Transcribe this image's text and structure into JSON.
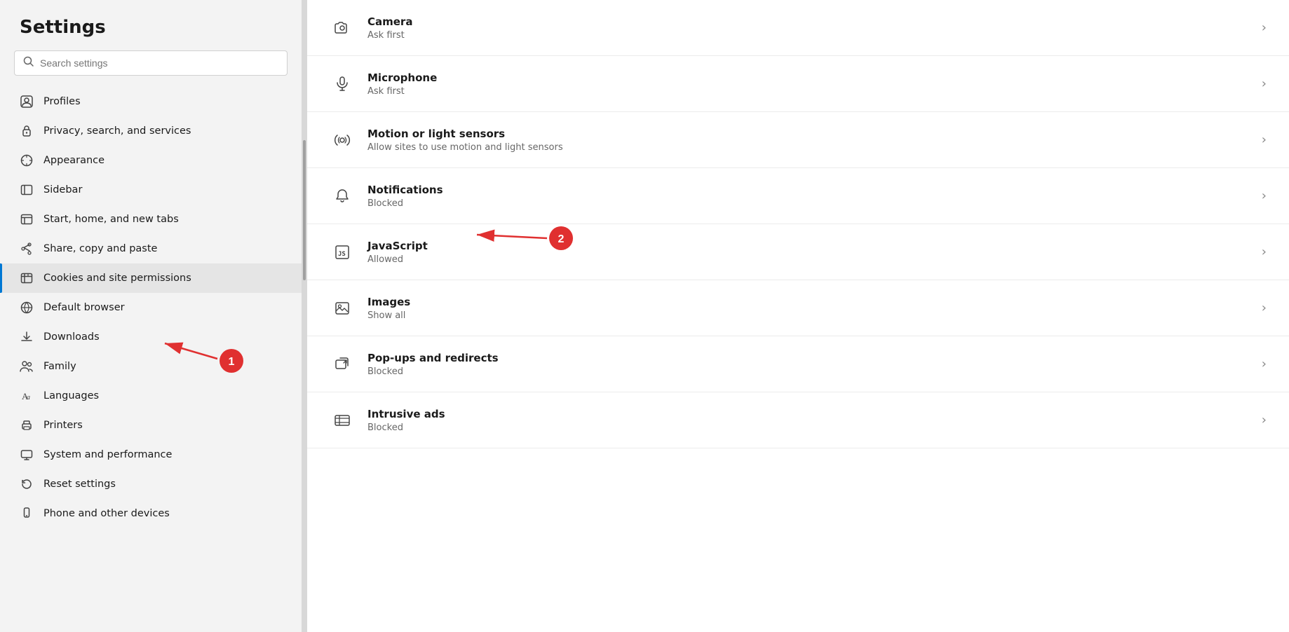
{
  "sidebar": {
    "title": "Settings",
    "search": {
      "placeholder": "Search settings"
    },
    "items": [
      {
        "id": "profiles",
        "label": "Profiles",
        "icon": "profile"
      },
      {
        "id": "privacy",
        "label": "Privacy, search, and services",
        "icon": "privacy"
      },
      {
        "id": "appearance",
        "label": "Appearance",
        "icon": "appearance"
      },
      {
        "id": "sidebar",
        "label": "Sidebar",
        "icon": "sidebar"
      },
      {
        "id": "start-home",
        "label": "Start, home, and new tabs",
        "icon": "start-home"
      },
      {
        "id": "share-copy",
        "label": "Share, copy and paste",
        "icon": "share"
      },
      {
        "id": "cookies",
        "label": "Cookies and site permissions",
        "icon": "cookies",
        "active": true
      },
      {
        "id": "default-browser",
        "label": "Default browser",
        "icon": "browser"
      },
      {
        "id": "downloads",
        "label": "Downloads",
        "icon": "downloads"
      },
      {
        "id": "family",
        "label": "Family",
        "icon": "family"
      },
      {
        "id": "languages",
        "label": "Languages",
        "icon": "languages"
      },
      {
        "id": "printers",
        "label": "Printers",
        "icon": "printers"
      },
      {
        "id": "system",
        "label": "System and performance",
        "icon": "system"
      },
      {
        "id": "reset",
        "label": "Reset settings",
        "icon": "reset"
      },
      {
        "id": "phone",
        "label": "Phone and other devices",
        "icon": "phone"
      }
    ]
  },
  "permissions": [
    {
      "id": "camera",
      "title": "Camera",
      "subtitle": "Ask first",
      "icon": "camera"
    },
    {
      "id": "microphone",
      "title": "Microphone",
      "subtitle": "Ask first",
      "icon": "microphone"
    },
    {
      "id": "motion",
      "title": "Motion or light sensors",
      "subtitle": "Allow sites to use motion and light sensors",
      "icon": "sensors"
    },
    {
      "id": "notifications",
      "title": "Notifications",
      "subtitle": "Blocked",
      "icon": "notifications"
    },
    {
      "id": "javascript",
      "title": "JavaScript",
      "subtitle": "Allowed",
      "icon": "javascript"
    },
    {
      "id": "images",
      "title": "Images",
      "subtitle": "Show all",
      "icon": "images"
    },
    {
      "id": "popups",
      "title": "Pop-ups and redirects",
      "subtitle": "Blocked",
      "icon": "popups"
    },
    {
      "id": "intrusive-ads",
      "title": "Intrusive ads",
      "subtitle": "Blocked",
      "icon": "ads"
    }
  ],
  "annotations": {
    "badge1": "1",
    "badge2": "2"
  }
}
